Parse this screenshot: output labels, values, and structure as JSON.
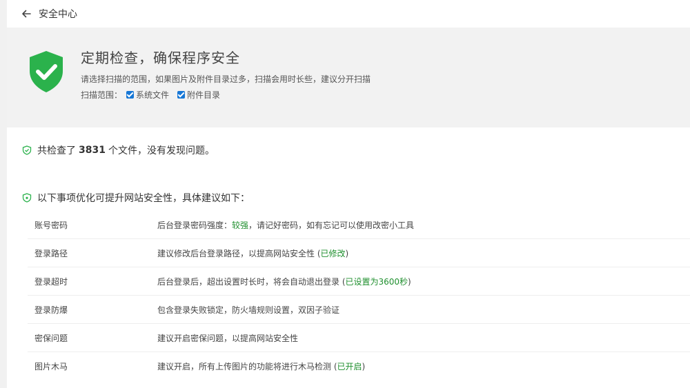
{
  "header": {
    "title": "安全中心"
  },
  "hero": {
    "title": "定期检查，确保程序安全",
    "description": "请选择扫描的范围，如果图片及附件目录过多，扫描会用时长些，建议分开扫描",
    "scope_label": "扫描范围：",
    "options": [
      {
        "label": "系统文件",
        "checked": true
      },
      {
        "label": "附件目录",
        "checked": true
      }
    ]
  },
  "result": {
    "prefix": "共检查了",
    "count": "3831",
    "suffix": "个文件，没有发现问题。"
  },
  "suggestions": {
    "heading": "以下事项优化可提升网站安全性，具体建议如下：",
    "rows": [
      {
        "name": "账号密码",
        "text": "后台登录密码强度：",
        "highlight": "较强",
        "tail": "，请记好密码，如有忘记可以使用改密小工具"
      },
      {
        "name": "登录路径",
        "text": "建议修改后台登录路径，以提高网站安全性 (",
        "highlight": "已修改",
        "tail": ")"
      },
      {
        "name": "登录超时",
        "text": "后台登录后，超出设置时长时，将会自动退出登录 (",
        "highlight": "已设置为3600秒",
        "tail": ")"
      },
      {
        "name": "登录防爆",
        "text": "包含登录失败锁定，防火墙规则设置，双因子验证",
        "highlight": "",
        "tail": ""
      },
      {
        "name": "密保问题",
        "text": "建议开启密保问题，以提高网站安全性",
        "highlight": "",
        "tail": ""
      },
      {
        "name": "图片木马",
        "text": "建议开启，所有上传图片的功能将进行木马检测 (",
        "highlight": "已开启",
        "tail": ")"
      }
    ]
  },
  "colors": {
    "accent_green": "#2bb24c",
    "checkbox_blue": "#1677d6",
    "status_green": "#1f8f2e"
  }
}
